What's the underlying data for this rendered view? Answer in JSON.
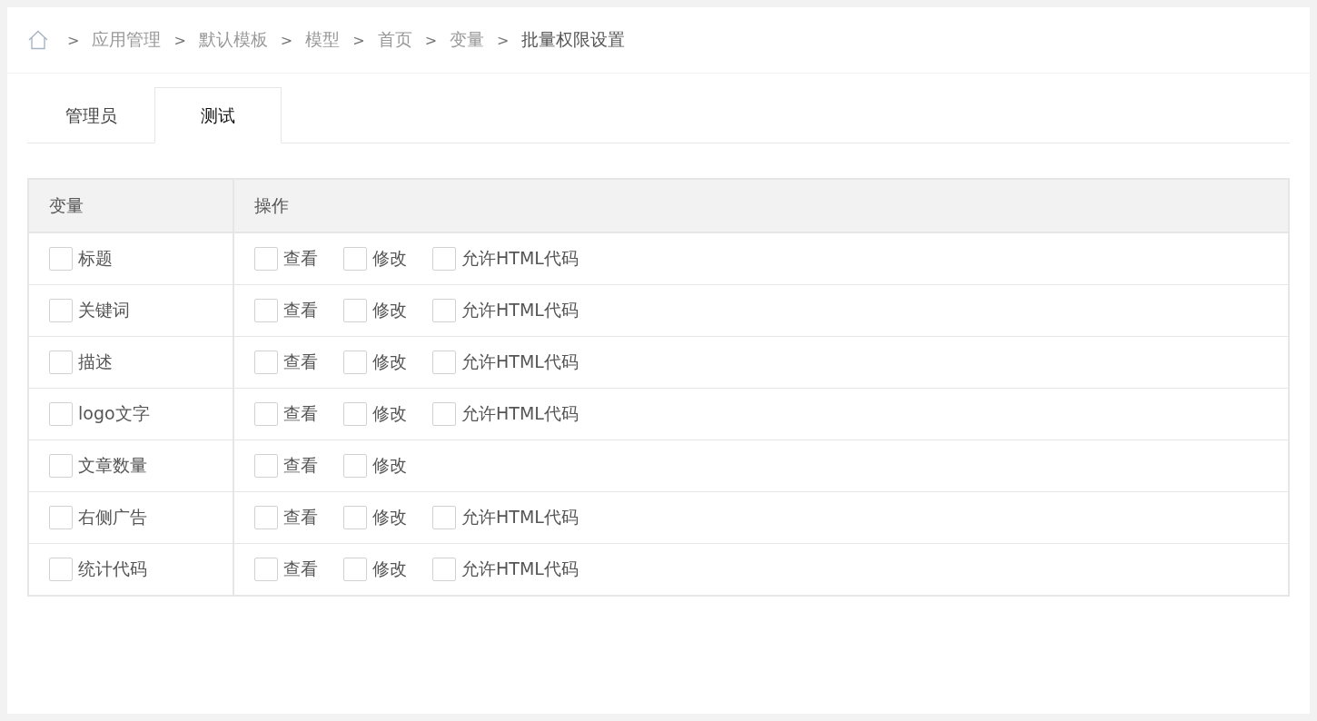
{
  "breadcrumb": [
    {
      "sep": ">",
      "label": "应用管理",
      "current": false
    },
    {
      "sep": ">",
      "label": "默认模板",
      "current": false
    },
    {
      "sep": ">",
      "label": "模型",
      "current": false
    },
    {
      "sep": ">",
      "label": "首页",
      "current": false
    },
    {
      "sep": ">",
      "label": "变量",
      "current": false
    },
    {
      "sep": ">",
      "label": "批量权限设置",
      "current": true
    }
  ],
  "tabs": [
    {
      "label": "管理员",
      "selected": false
    },
    {
      "label": "测试",
      "selected": true
    }
  ],
  "table": {
    "columns": [
      "变量",
      "操作"
    ],
    "rows": [
      {
        "name": "标题",
        "checked": false,
        "actions": [
          {
            "label": "查看",
            "checked": false
          },
          {
            "label": "修改",
            "checked": false
          },
          {
            "label": "允许HTML代码",
            "checked": false
          }
        ]
      },
      {
        "name": "关键词",
        "checked": false,
        "actions": [
          {
            "label": "查看",
            "checked": false
          },
          {
            "label": "修改",
            "checked": false
          },
          {
            "label": "允许HTML代码",
            "checked": false
          }
        ]
      },
      {
        "name": "描述",
        "checked": false,
        "actions": [
          {
            "label": "查看",
            "checked": false
          },
          {
            "label": "修改",
            "checked": false
          },
          {
            "label": "允许HTML代码",
            "checked": false
          }
        ]
      },
      {
        "name": "logo文字",
        "checked": false,
        "actions": [
          {
            "label": "查看",
            "checked": false
          },
          {
            "label": "修改",
            "checked": false
          },
          {
            "label": "允许HTML代码",
            "checked": false
          }
        ]
      },
      {
        "name": "文章数量",
        "checked": false,
        "actions": [
          {
            "label": "查看",
            "checked": false
          },
          {
            "label": "修改",
            "checked": false
          }
        ]
      },
      {
        "name": "右侧广告",
        "checked": false,
        "actions": [
          {
            "label": "查看",
            "checked": false
          },
          {
            "label": "修改",
            "checked": false
          },
          {
            "label": "允许HTML代码",
            "checked": false
          }
        ]
      },
      {
        "name": "统计代码",
        "checked": false,
        "actions": [
          {
            "label": "查看",
            "checked": false
          },
          {
            "label": "修改",
            "checked": false
          },
          {
            "label": "允许HTML代码",
            "checked": false
          }
        ]
      }
    ]
  }
}
